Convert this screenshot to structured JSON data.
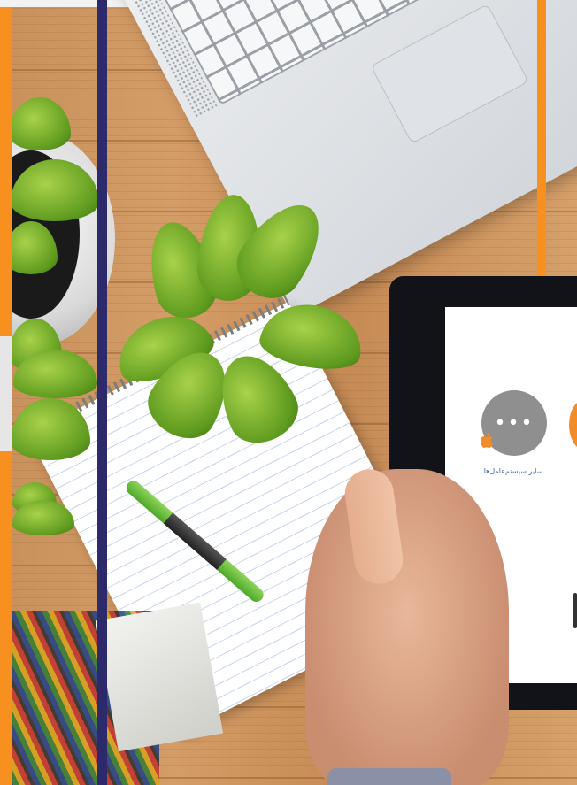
{
  "tablet": {
    "os_label": "سایر سیستم‌عامل‌ها",
    "grey_icon_glyph": "•••"
  },
  "colors": {
    "brand_orange": "#f7901e",
    "brand_navy": "#2c2a6b",
    "label_blue": "#2c5d9a",
    "icon_grey": "#8f8f8f"
  },
  "icons": [
    "more-dots-icon",
    "apple-icon"
  ]
}
